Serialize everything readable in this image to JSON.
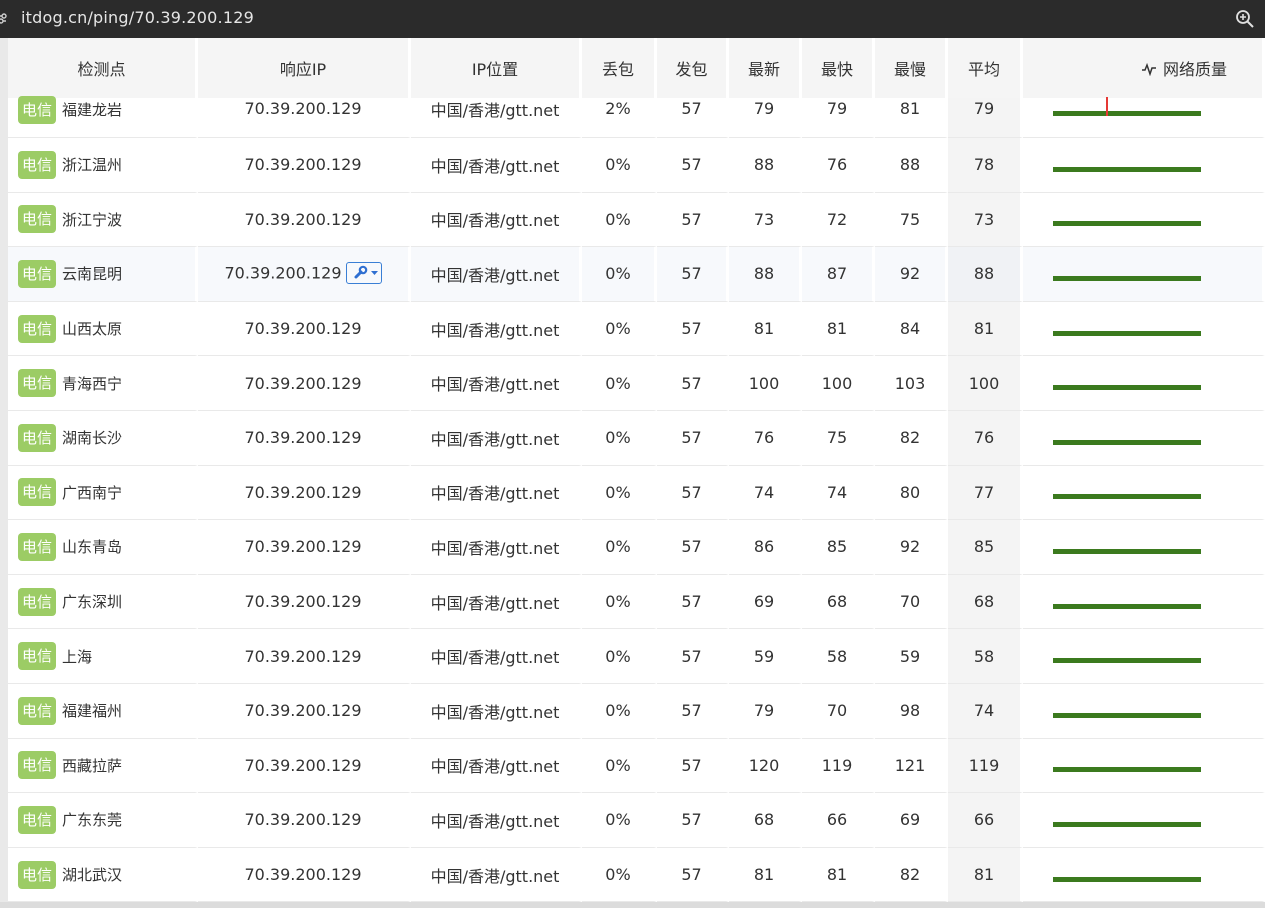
{
  "browser": {
    "url": "itdog.cn/ping/70.39.200.129",
    "site_icon": "settings-tune-icon",
    "zoom_icon": "zoom-in-icon"
  },
  "colors": {
    "badge": "#9ccc65",
    "bar_ok": "#3b7a1e",
    "bar_loss": "#e53935",
    "tool_button": "#3a7fd5"
  },
  "table": {
    "headers": {
      "node": "检测点",
      "ip": "响应IP",
      "location": "IP位置",
      "loss": "丢包",
      "sent": "发包",
      "latest": "最新",
      "fastest": "最快",
      "slowest": "最慢",
      "avg": "平均",
      "quality": "网络质量"
    },
    "quality_icon": "pulse-icon",
    "rows": [
      {
        "isp": "电信",
        "node": "福建龙岩",
        "ip": "70.39.200.129",
        "location": "中国/香港/gtt.net",
        "loss": "2%",
        "sent": "57",
        "latest": "79",
        "fastest": "79",
        "slowest": "81",
        "avg": "79",
        "quality": {
          "loss_spikes": [
            0.36
          ]
        }
      },
      {
        "isp": "电信",
        "node": "浙江温州",
        "ip": "70.39.200.129",
        "location": "中国/香港/gtt.net",
        "loss": "0%",
        "sent": "57",
        "latest": "88",
        "fastest": "76",
        "slowest": "88",
        "avg": "78",
        "quality": {
          "loss_spikes": []
        }
      },
      {
        "isp": "电信",
        "node": "浙江宁波",
        "ip": "70.39.200.129",
        "location": "中国/香港/gtt.net",
        "loss": "0%",
        "sent": "57",
        "latest": "73",
        "fastest": "72",
        "slowest": "75",
        "avg": "73",
        "quality": {
          "loss_spikes": []
        }
      },
      {
        "isp": "电信",
        "node": "云南昆明",
        "ip": "70.39.200.129",
        "location": "中国/香港/gtt.net",
        "loss": "0%",
        "sent": "57",
        "latest": "88",
        "fastest": "87",
        "slowest": "92",
        "avg": "88",
        "quality": {
          "loss_spikes": []
        },
        "tool_button": "wrench-dropdown-icon",
        "highlighted": true
      },
      {
        "isp": "电信",
        "node": "山西太原",
        "ip": "70.39.200.129",
        "location": "中国/香港/gtt.net",
        "loss": "0%",
        "sent": "57",
        "latest": "81",
        "fastest": "81",
        "slowest": "84",
        "avg": "81",
        "quality": {
          "loss_spikes": []
        }
      },
      {
        "isp": "电信",
        "node": "青海西宁",
        "ip": "70.39.200.129",
        "location": "中国/香港/gtt.net",
        "loss": "0%",
        "sent": "57",
        "latest": "100",
        "fastest": "100",
        "slowest": "103",
        "avg": "100",
        "quality": {
          "loss_spikes": []
        }
      },
      {
        "isp": "电信",
        "node": "湖南长沙",
        "ip": "70.39.200.129",
        "location": "中国/香港/gtt.net",
        "loss": "0%",
        "sent": "57",
        "latest": "76",
        "fastest": "75",
        "slowest": "82",
        "avg": "76",
        "quality": {
          "loss_spikes": []
        }
      },
      {
        "isp": "电信",
        "node": "广西南宁",
        "ip": "70.39.200.129",
        "location": "中国/香港/gtt.net",
        "loss": "0%",
        "sent": "57",
        "latest": "74",
        "fastest": "74",
        "slowest": "80",
        "avg": "77",
        "quality": {
          "loss_spikes": []
        }
      },
      {
        "isp": "电信",
        "node": "山东青岛",
        "ip": "70.39.200.129",
        "location": "中国/香港/gtt.net",
        "loss": "0%",
        "sent": "57",
        "latest": "86",
        "fastest": "85",
        "slowest": "92",
        "avg": "85",
        "quality": {
          "loss_spikes": []
        }
      },
      {
        "isp": "电信",
        "node": "广东深圳",
        "ip": "70.39.200.129",
        "location": "中国/香港/gtt.net",
        "loss": "0%",
        "sent": "57",
        "latest": "69",
        "fastest": "68",
        "slowest": "70",
        "avg": "68",
        "quality": {
          "loss_spikes": []
        }
      },
      {
        "isp": "电信",
        "node": "上海",
        "ip": "70.39.200.129",
        "location": "中国/香港/gtt.net",
        "loss": "0%",
        "sent": "57",
        "latest": "59",
        "fastest": "58",
        "slowest": "59",
        "avg": "58",
        "quality": {
          "loss_spikes": []
        }
      },
      {
        "isp": "电信",
        "node": "福建福州",
        "ip": "70.39.200.129",
        "location": "中国/香港/gtt.net",
        "loss": "0%",
        "sent": "57",
        "latest": "79",
        "fastest": "70",
        "slowest": "98",
        "avg": "74",
        "quality": {
          "loss_spikes": []
        }
      },
      {
        "isp": "电信",
        "node": "西藏拉萨",
        "ip": "70.39.200.129",
        "location": "中国/香港/gtt.net",
        "loss": "0%",
        "sent": "57",
        "latest": "120",
        "fastest": "119",
        "slowest": "121",
        "avg": "119",
        "quality": {
          "loss_spikes": []
        }
      },
      {
        "isp": "电信",
        "node": "广东东莞",
        "ip": "70.39.200.129",
        "location": "中国/香港/gtt.net",
        "loss": "0%",
        "sent": "57",
        "latest": "68",
        "fastest": "66",
        "slowest": "69",
        "avg": "66",
        "quality": {
          "loss_spikes": []
        }
      },
      {
        "isp": "电信",
        "node": "湖北武汉",
        "ip": "70.39.200.129",
        "location": "中国/香港/gtt.net",
        "loss": "0%",
        "sent": "57",
        "latest": "81",
        "fastest": "81",
        "slowest": "82",
        "avg": "81",
        "quality": {
          "loss_spikes": []
        }
      }
    ]
  }
}
